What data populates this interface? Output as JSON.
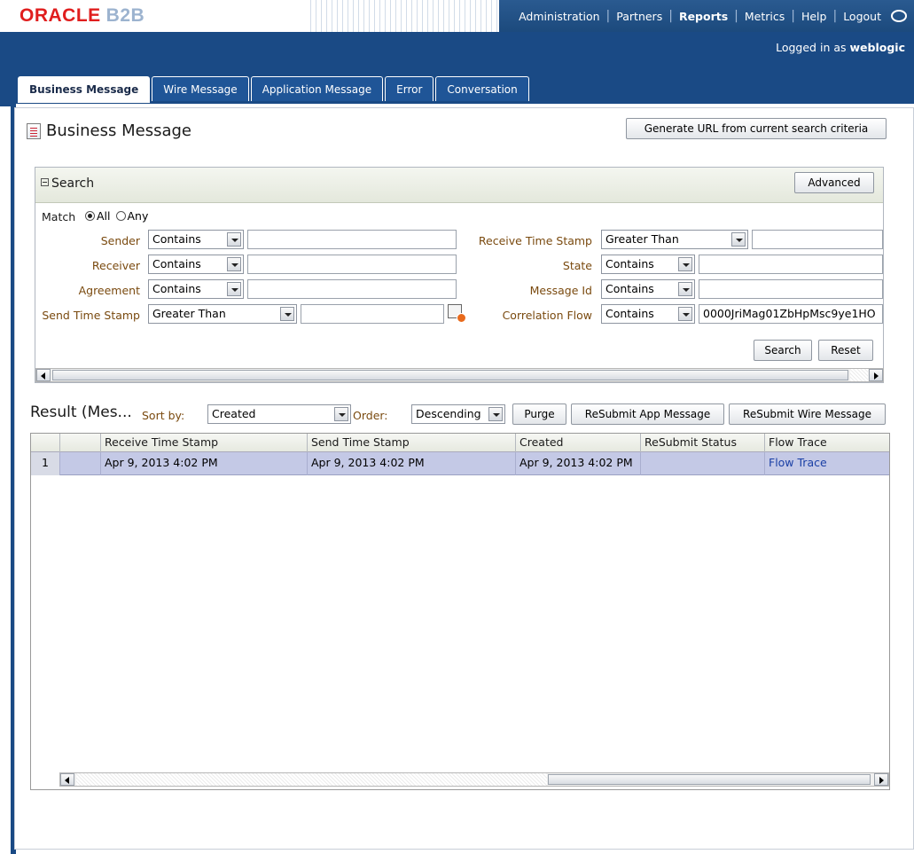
{
  "header": {
    "brand": "ORACLE",
    "product": "B2B",
    "nav": [
      "Administration",
      "Partners",
      "Reports",
      "Metrics",
      "Help",
      "Logout"
    ],
    "active_nav": "Reports",
    "logged_in_prefix": "Logged in as",
    "logged_in_user": "weblogic"
  },
  "tabs": [
    "Business Message",
    "Wire Message",
    "Application Message",
    "Error",
    "Conversation"
  ],
  "active_tab": "Business Message",
  "page": {
    "title": "Business Message",
    "generate_url_button": "Generate URL from current search criteria"
  },
  "search": {
    "title": "Search",
    "advanced_button": "Advanced",
    "match_label": "Match",
    "match_all": "All",
    "match_any": "Any",
    "match_selected": "All",
    "sender": {
      "label": "Sender",
      "operator": "Contains",
      "value": ""
    },
    "receiver": {
      "label": "Receiver",
      "operator": "Contains",
      "value": ""
    },
    "agreement": {
      "label": "Agreement",
      "operator": "Contains",
      "value": ""
    },
    "send_time": {
      "label": "Send Time Stamp",
      "operator": "Greater Than",
      "value": ""
    },
    "receive_time": {
      "label": "Receive Time Stamp",
      "operator": "Greater Than",
      "value": ""
    },
    "state": {
      "label": "State",
      "operator": "Contains",
      "value": ""
    },
    "message_id": {
      "label": "Message Id",
      "operator": "Contains",
      "value": ""
    },
    "correlation_flow": {
      "label": "Correlation Flow",
      "operator": "Contains",
      "value": "0000JriMag01ZbHpMsc9ye1HO"
    },
    "search_button": "Search",
    "reset_button": "Reset"
  },
  "result": {
    "title": "Result (Mes...",
    "sort_by_label": "Sort by:",
    "sort_by_value": "Created",
    "order_label": "Order:",
    "order_value": "Descending",
    "purge_button": "Purge",
    "resubmit_app_button": "ReSubmit App Message",
    "resubmit_wire_button": "ReSubmit Wire Message",
    "columns": [
      "Receive Time Stamp",
      "Send Time Stamp",
      "Created",
      "ReSubmit Status",
      "Flow Trace"
    ],
    "rows": [
      {
        "num": "1",
        "receive": "Apr 9, 2013 4:02 PM",
        "send": "Apr 9, 2013 4:02 PM",
        "created": "Apr 9, 2013 4:02 PM",
        "resubmit_status": "",
        "flow_trace": "Flow Trace"
      }
    ]
  },
  "colors": {
    "brand_red": "#e01e1e",
    "nav_blue": "#1a4a85",
    "label_brown": "#7a4a0f",
    "selected_row": "#c4c9e6",
    "link": "#1a3fa5"
  }
}
